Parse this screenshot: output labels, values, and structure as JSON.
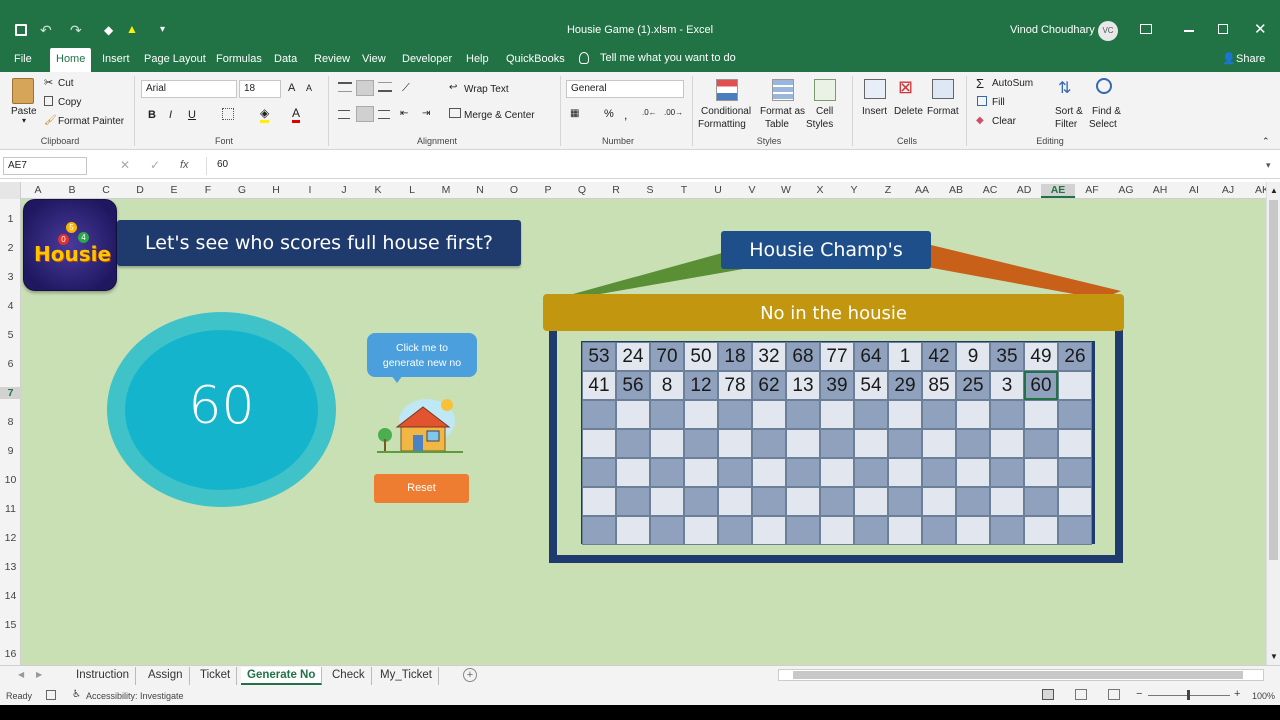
{
  "titlebar": {
    "file_name": "Housie Game (1).xlsm  -  Excel",
    "user_name": "Vinod Choudhary",
    "user_initials": "VC"
  },
  "ribbon_tabs": [
    "File",
    "Home",
    "Insert",
    "Page Layout",
    "Formulas",
    "Data",
    "Review",
    "View",
    "Developer",
    "Help",
    "QuickBooks"
  ],
  "tell_me": "Tell me what you want to do",
  "share": "Share",
  "clipboard": {
    "paste": "Paste",
    "cut": "Cut",
    "copy": "Copy",
    "format_painter": "Format Painter",
    "label": "Clipboard"
  },
  "font": {
    "name": "Arial",
    "size": "18",
    "label": "Font",
    "bold": "B",
    "italic": "I",
    "underline": "U"
  },
  "alignment": {
    "wrap_text": "Wrap Text",
    "merge_center": "Merge & Center",
    "label": "Alignment"
  },
  "number": {
    "format": "General",
    "percent": "%",
    "label": "Number"
  },
  "styles": {
    "conditional_1": "Conditional",
    "conditional_2": "Formatting",
    "format_table_1": "Format as",
    "format_table_2": "Table",
    "cell_styles_1": "Cell",
    "cell_styles_2": "Styles",
    "label": "Styles"
  },
  "cells": {
    "insert": "Insert",
    "delete": "Delete",
    "format": "Format",
    "label": "Cells"
  },
  "editing": {
    "autosum": "AutoSum",
    "fill": "Fill",
    "clear": "Clear",
    "sort_1": "Sort &",
    "sort_2": "Filter",
    "find_1": "Find &",
    "find_2": "Select",
    "label": "Editing"
  },
  "formula_bar": {
    "name_box": "AE7",
    "fx": "fx",
    "value": "60"
  },
  "columns": [
    "A",
    "B",
    "C",
    "D",
    "E",
    "F",
    "G",
    "H",
    "I",
    "J",
    "K",
    "L",
    "M",
    "N",
    "O",
    "P",
    "Q",
    "R",
    "S",
    "T",
    "U",
    "V",
    "W",
    "X",
    "Y",
    "Z",
    "AA",
    "AB",
    "AC",
    "AD",
    "AE",
    "AF",
    "AG",
    "AH",
    "AI",
    "AJ",
    "AK"
  ],
  "rows": [
    "1",
    "2",
    "3",
    "4",
    "5",
    "6",
    "7",
    "8",
    "9",
    "10",
    "11",
    "12",
    "13",
    "14",
    "15",
    "16"
  ],
  "game": {
    "logo_text": "Housie",
    "logo_balls": [
      "5",
      "0",
      "4"
    ],
    "banner": "Let's see who scores full house first?",
    "current_number": "60",
    "tooltip": "Click me to generate new no",
    "reset": "Reset",
    "champ_title": "Housie Champ's",
    "board_title": "No in the housie",
    "board_row1": [
      "53",
      "24",
      "70",
      "50",
      "18",
      "32",
      "68",
      "77",
      "64",
      "1",
      "42",
      "9",
      "35",
      "49",
      "26"
    ],
    "board_row2": [
      "41",
      "56",
      "8",
      "12",
      "78",
      "62",
      "13",
      "39",
      "54",
      "29",
      "85",
      "25",
      "3",
      "60",
      ""
    ]
  },
  "sheet_tabs": [
    "Instruction",
    "Assign",
    "Ticket",
    "Generate No",
    "Check",
    "My_Ticket"
  ],
  "active_sheet": "Generate No",
  "status": {
    "ready": "Ready",
    "accessibility": "Accessibility: Investigate",
    "zoom": "100%"
  },
  "colors": {
    "excel_green": "#217346",
    "sheet_bg": "#c9e0b5",
    "banner_navy": "#1f3b6e",
    "board_gold": "#c2960e",
    "number_teal": "#14b5cc",
    "reset_orange": "#ee7d32"
  }
}
